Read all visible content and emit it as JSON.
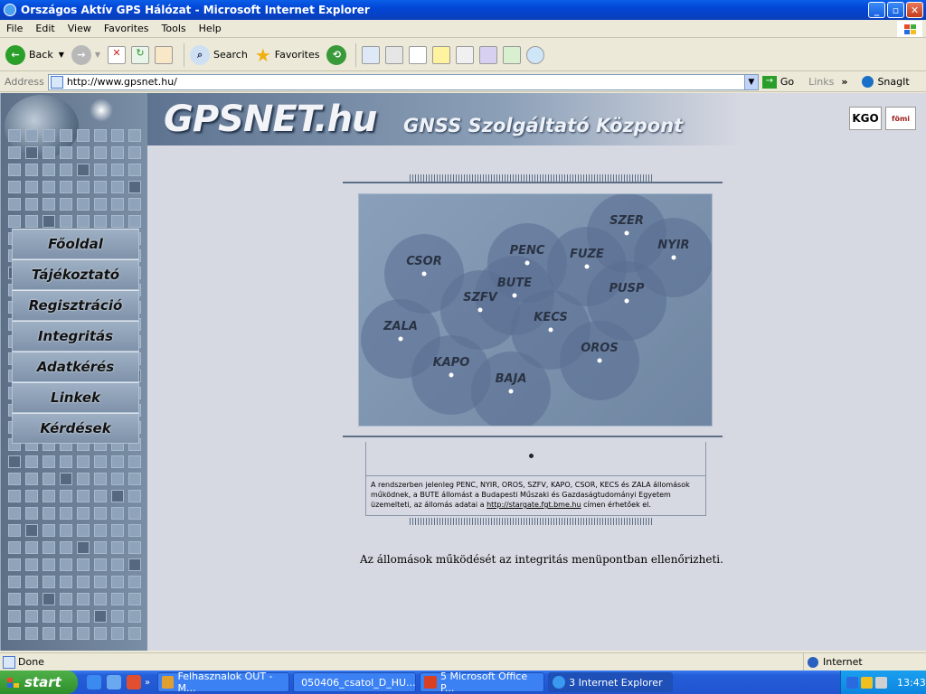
{
  "window": {
    "title": "Országos Aktív GPS Hálózat - Microsoft Internet Explorer"
  },
  "menu": [
    "File",
    "Edit",
    "View",
    "Favorites",
    "Tools",
    "Help"
  ],
  "toolbar": {
    "back": "Back",
    "search": "Search",
    "favorites": "Favorites"
  },
  "address": {
    "label": "Address",
    "url": "http://www.gpsnet.hu/",
    "go": "Go",
    "links": "Links",
    "snagit": "SnagIt"
  },
  "site": {
    "name": "GPSNET.hu",
    "subtitle": "GNSS Szolgáltató Központ",
    "logo_kgo": "KGO",
    "logo_fomi": "fömi"
  },
  "nav": [
    "Főoldal",
    "Tájékoztató",
    "Regisztráció",
    "Integritás",
    "Adatkérés",
    "Linkek",
    "Kérdések"
  ],
  "stations": [
    "CSOR",
    "PENC",
    "FUZE",
    "SZER",
    "NYIR",
    "BUTE",
    "SZFV",
    "PUSP",
    "ZALA",
    "KECS",
    "OROS",
    "KAPO",
    "BAJA"
  ],
  "info": {
    "text_before": "A rendszerben jelenleg PENC, NYIR, OROS, SZFV, KAPO, CSOR, KECS és ZALA állomások működnek, a BUTE állomást a Budapesti Műszaki és Gazdaságtudományi Egyetem üzemelteti, az állomás adatai a",
    "link": "http://stargate.fgt.bme.hu",
    "text_after": "címen érhetőek el."
  },
  "footer": "Az állomások működését az integritás menüpontban ellenőrizheti.",
  "status": {
    "text": "Done",
    "zone": "Internet"
  },
  "taskbar": {
    "start": "start",
    "tasks": [
      "Felhasznalok OUT - M...",
      "050406_csatol_D_HU...",
      "5 Microsoft Office P...",
      "3 Internet Explorer"
    ],
    "clock": "13:43"
  }
}
